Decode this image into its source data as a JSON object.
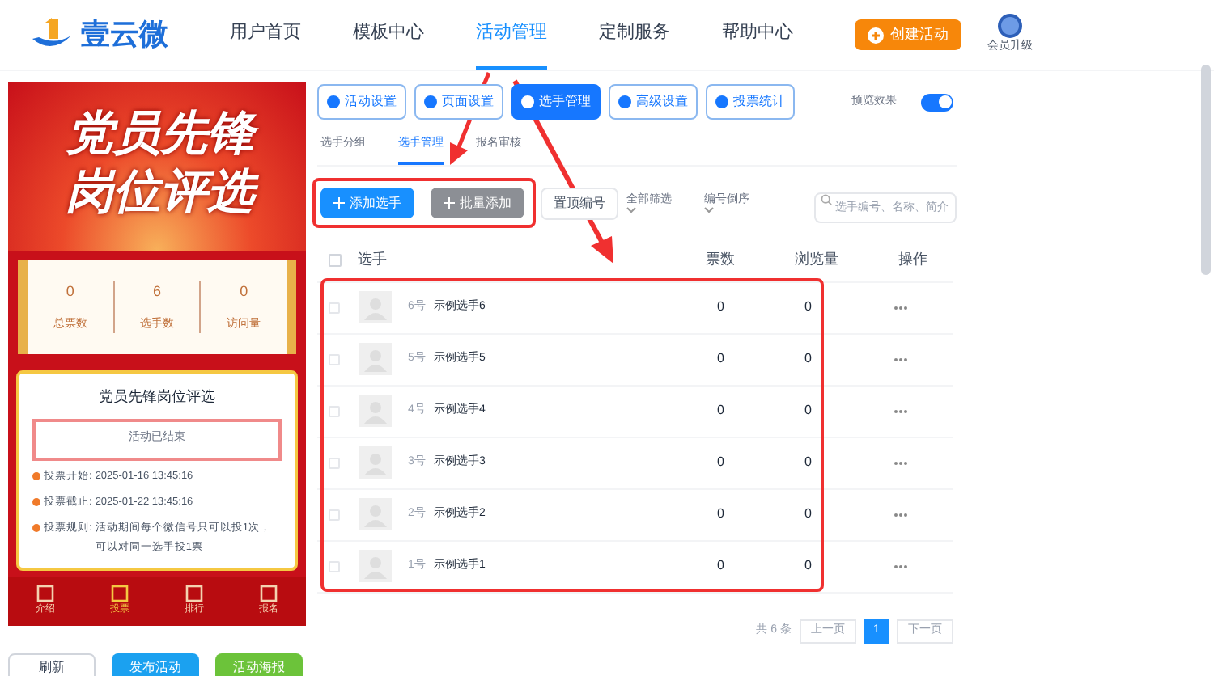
{
  "header": {
    "logo": "壹云微",
    "nav": [
      {
        "label": "用户首页",
        "selected": false
      },
      {
        "label": "模板中心",
        "selected": false
      },
      {
        "label": "活动管理",
        "selected": true
      },
      {
        "label": "定制服务",
        "selected": false
      },
      {
        "label": "帮助中心",
        "selected": false
      }
    ],
    "create_button": "创建活动",
    "vip_label": "会员升级"
  },
  "preview": {
    "banner_title": "党员先锋岗位评选",
    "stats": [
      {
        "value": "0",
        "label": "总票数"
      },
      {
        "value": "6",
        "label": "选手数"
      },
      {
        "value": "0",
        "label": "访问量"
      }
    ],
    "card": {
      "title": "党员先锋岗位评选",
      "status": "活动已结束",
      "info": [
        {
          "label": "投票开始:",
          "value": "2025-01-16 13:45:16"
        },
        {
          "label": "投票截止:",
          "value": "2025-01-22 13:45:16"
        },
        {
          "label": "投票规则:",
          "value": "活动期间每个微信号只可以投1次，可以对同一选手投1票"
        }
      ]
    },
    "tabbar": [
      {
        "label": "介绍",
        "selected": false
      },
      {
        "label": "投票",
        "selected": true
      },
      {
        "label": "排行",
        "selected": false
      },
      {
        "label": "报名",
        "selected": false
      }
    ]
  },
  "bottom_buttons": [
    {
      "label": "刷新",
      "kind": "plain"
    },
    {
      "label": "发布活动",
      "kind": "blue"
    },
    {
      "label": "活动海报",
      "kind": "green"
    }
  ],
  "toolbar": [
    {
      "label": "活动设置",
      "selected": false
    },
    {
      "label": "页面设置",
      "selected": false
    },
    {
      "label": "选手管理",
      "selected": true
    },
    {
      "label": "高级设置",
      "selected": false
    },
    {
      "label": "投票统计",
      "selected": false
    }
  ],
  "preview_toggle": {
    "label": "预览效果",
    "on": true
  },
  "subtabs": [
    {
      "label": "选手分组",
      "selected": false
    },
    {
      "label": "选手管理",
      "selected": true
    },
    {
      "label": "报名审核",
      "selected": false
    }
  ],
  "actions": {
    "add": "添加选手",
    "batch": "批量添加",
    "pin": "置顶编号",
    "filter": "全部筛选",
    "sort": "编号倒序",
    "search_placeholder": "选手编号、名称、简介"
  },
  "table": {
    "select_all_checked": false,
    "columns": [
      "选手",
      "票数",
      "浏览量",
      "操作"
    ],
    "rows": [
      {
        "number": "6号",
        "name": "示例选手6",
        "votes": "0",
        "views": "0",
        "checked": false
      },
      {
        "number": "5号",
        "name": "示例选手5",
        "votes": "0",
        "views": "0",
        "checked": false
      },
      {
        "number": "4号",
        "name": "示例选手4",
        "votes": "0",
        "views": "0",
        "checked": false
      },
      {
        "number": "3号",
        "name": "示例选手3",
        "votes": "0",
        "views": "0",
        "checked": false
      },
      {
        "number": "2号",
        "name": "示例选手2",
        "votes": "0",
        "views": "0",
        "checked": false
      },
      {
        "number": "1号",
        "name": "示例选手1",
        "votes": "0",
        "views": "0",
        "checked": false
      }
    ]
  },
  "pagination": {
    "total": "共 6 条",
    "prev": "上一页",
    "pages": [
      {
        "label": "1",
        "selected": true
      }
    ],
    "next": "下一页"
  }
}
